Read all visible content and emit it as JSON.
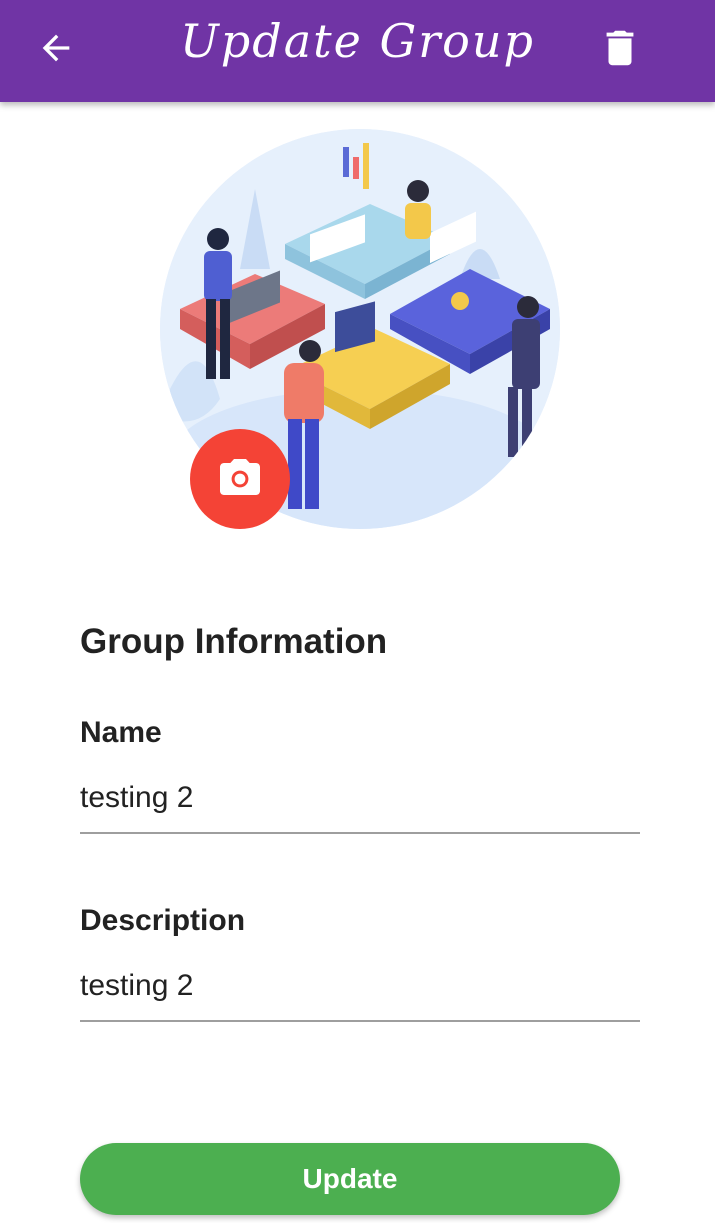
{
  "appbar": {
    "title": "Update Group",
    "back_icon": "arrow-back-icon",
    "delete_icon": "trash-icon",
    "background_color": "#7034a5"
  },
  "avatar": {
    "camera_icon": "camera-icon",
    "camera_button_color": "#f44336"
  },
  "form": {
    "section_title": "Group Information",
    "name": {
      "label": "Name",
      "value": "testing 2"
    },
    "description": {
      "label": "Description",
      "value": "testing 2"
    }
  },
  "actions": {
    "update_label": "Update",
    "update_color": "#4caf50"
  }
}
